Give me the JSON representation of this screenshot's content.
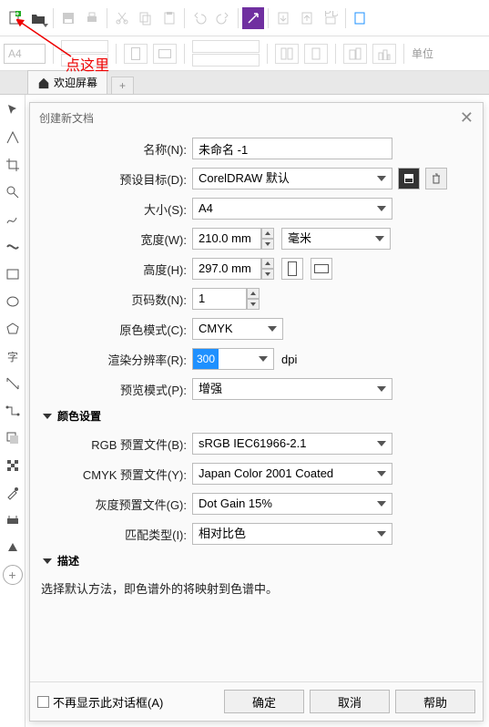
{
  "annotation": {
    "text": "点这里"
  },
  "tabs": {
    "welcome": "欢迎屏幕",
    "add": "+"
  },
  "toolbar2": {
    "preset": "A4",
    "unit_label": "单位"
  },
  "dialog": {
    "title": "创建新文档",
    "labels": {
      "name": "名称(N):",
      "preset": "预设目标(D):",
      "size": "大小(S):",
      "width": "宽度(W):",
      "height": "高度(H):",
      "pages": "页码数(N):",
      "colormode": "原色模式(C):",
      "render_res": "渲染分辨率(R):",
      "preview": "预览模式(P):",
      "rgb_profile": "RGB 预置文件(B):",
      "cmyk_profile": "CMYK 预置文件(Y):",
      "gray_profile": "灰度预置文件(G):",
      "match_type": "匹配类型(I):"
    },
    "values": {
      "name": "未命名 -1",
      "preset": "CorelDRAW 默认",
      "size": "A4",
      "width": "210.0 mm",
      "height": "297.0 mm",
      "unit": "毫米",
      "pages": "1",
      "colormode": "CMYK",
      "render_res": "300",
      "render_res_unit": "dpi",
      "preview": "增强",
      "rgb_profile": "sRGB IEC61966-2.1",
      "cmyk_profile": "Japan Color 2001 Coated",
      "gray_profile": "Dot Gain 15%",
      "match_type": "相对比色"
    },
    "sections": {
      "color": "颜色设置",
      "desc": "描述"
    },
    "desc_text": "选择默认方法，即色谱外的将映射到色谱中。",
    "footer": {
      "dont_show": "不再显示此对话框(A)",
      "ok": "确定",
      "cancel": "取消",
      "help": "帮助"
    }
  }
}
